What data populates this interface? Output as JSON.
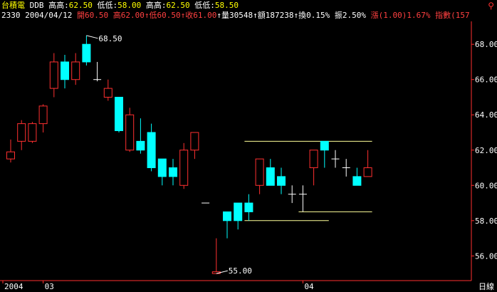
{
  "header": {
    "title": "台積電",
    "freq": "DDB",
    "hh_label": "高高:",
    "hh_val": "62.50",
    "ll_label": "低低:",
    "ll_val": "58.00",
    "hh2_label": "高高:",
    "hh2_val": "62.50",
    "ll2_label": "低低:",
    "ll2_val": "58.50",
    "pin_icon": "pin-icon"
  },
  "quote": {
    "code": "2330",
    "date": "2004/04/12",
    "open": "開60.50",
    "high": "高62.00",
    "low": "↑低60.50",
    "close": "↑收61.00",
    "volume": "↑量30548",
    "amount": "↑額187238",
    "turnover": "↑換0.15%",
    "amplitude": "振2.50%",
    "change": "漲(1.00)1.67%",
    "index": "指數(157"
  },
  "colors": {
    "up": "#ff3030",
    "down": "#00ffff",
    "axis": "#ff3030",
    "label": "#ffffff",
    "resistance": "#ffff99"
  },
  "axis_corner": "日線",
  "chart_data": {
    "type": "candlestick",
    "ylim": [
      54.6,
      69.3
    ],
    "yticks": [
      "56.00",
      "58.00",
      "60.00",
      "62.00",
      "64.00",
      "66.00",
      "68.00"
    ],
    "xlabels": [
      "2004",
      "03",
      "04"
    ],
    "candles": [
      {
        "o": 61.5,
        "h": 62.6,
        "l": 61.3,
        "c": 61.9
      },
      {
        "o": 62.5,
        "h": 63.7,
        "l": 62.0,
        "c": 63.5
      },
      {
        "o": 62.5,
        "h": 63.6,
        "l": 62.4,
        "c": 63.5
      },
      {
        "o": 63.5,
        "h": 64.6,
        "l": 63.0,
        "c": 64.5
      },
      {
        "o": 65.5,
        "h": 67.5,
        "l": 65.0,
        "c": 67.0
      },
      {
        "o": 67.0,
        "h": 67.4,
        "l": 65.5,
        "c": 66.0
      },
      {
        "o": 66.0,
        "h": 67.5,
        "l": 65.7,
        "c": 67.0
      },
      {
        "o": 68.0,
        "h": 68.5,
        "l": 66.8,
        "c": 67.0
      },
      {
        "o": 66.0,
        "h": 67.0,
        "l": 65.9,
        "c": 66.0
      },
      {
        "o": 65.0,
        "h": 66.0,
        "l": 64.8,
        "c": 65.5
      },
      {
        "o": 65.0,
        "h": 65.0,
        "l": 63.0,
        "c": 63.1
      },
      {
        "o": 62.0,
        "h": 64.4,
        "l": 61.9,
        "c": 64.0
      },
      {
        "o": 62.5,
        "h": 63.8,
        "l": 61.8,
        "c": 62.0
      },
      {
        "o": 63.0,
        "h": 63.5,
        "l": 60.8,
        "c": 61.0
      },
      {
        "o": 61.5,
        "h": 61.5,
        "l": 60.0,
        "c": 60.5
      },
      {
        "o": 61.0,
        "h": 61.5,
        "l": 60.0,
        "c": 60.5
      },
      {
        "o": 60.0,
        "h": 62.4,
        "l": 59.8,
        "c": 62.0
      },
      {
        "o": 62.0,
        "h": 63.0,
        "l": 61.5,
        "c": 63.0
      },
      {
        "o": 59.0,
        "h": 59.0,
        "l": 59.0,
        "c": 59.0
      },
      {
        "o": 55.0,
        "h": 57.0,
        "l": 55.0,
        "c": 55.1
      },
      {
        "o": 58.5,
        "h": 58.5,
        "l": 57.0,
        "c": 58.0
      },
      {
        "o": 59.0,
        "h": 59.0,
        "l": 57.5,
        "c": 58.0
      },
      {
        "o": 59.0,
        "h": 59.5,
        "l": 58.0,
        "c": 58.5
      },
      {
        "o": 60.0,
        "h": 61.5,
        "l": 59.5,
        "c": 61.5
      },
      {
        "o": 61.0,
        "h": 61.5,
        "l": 60.0,
        "c": 60.0
      },
      {
        "o": 60.5,
        "h": 61.0,
        "l": 59.5,
        "c": 60.0
      },
      {
        "o": 59.5,
        "h": 60.0,
        "l": 59.0,
        "c": 59.5
      },
      {
        "o": 59.5,
        "h": 60.0,
        "l": 58.5,
        "c": 59.5
      },
      {
        "o": 61.0,
        "h": 62.0,
        "l": 60.0,
        "c": 62.0
      },
      {
        "o": 62.5,
        "h": 62.5,
        "l": 61.0,
        "c": 62.0
      },
      {
        "o": 61.5,
        "h": 62.0,
        "l": 61.0,
        "c": 61.5
      },
      {
        "o": 61.0,
        "h": 61.5,
        "l": 60.5,
        "c": 61.0
      },
      {
        "o": 60.5,
        "h": 61.0,
        "l": 60.0,
        "c": 60.0
      },
      {
        "o": 60.5,
        "h": 62.0,
        "l": 60.5,
        "c": 61.0
      }
    ],
    "annotations": [
      {
        "text": "68.50",
        "value": 68.5,
        "candle": 7
      },
      {
        "text": "55.00",
        "value": 55.0,
        "candle": 19
      }
    ],
    "levels": [
      {
        "name": "high",
        "value": 62.5,
        "from": 22,
        "to": 33
      },
      {
        "name": "low",
        "value": 58.0,
        "from": 22,
        "to": 29
      },
      {
        "name": "low2",
        "value": 58.5,
        "from": 27,
        "to": 33
      }
    ]
  }
}
